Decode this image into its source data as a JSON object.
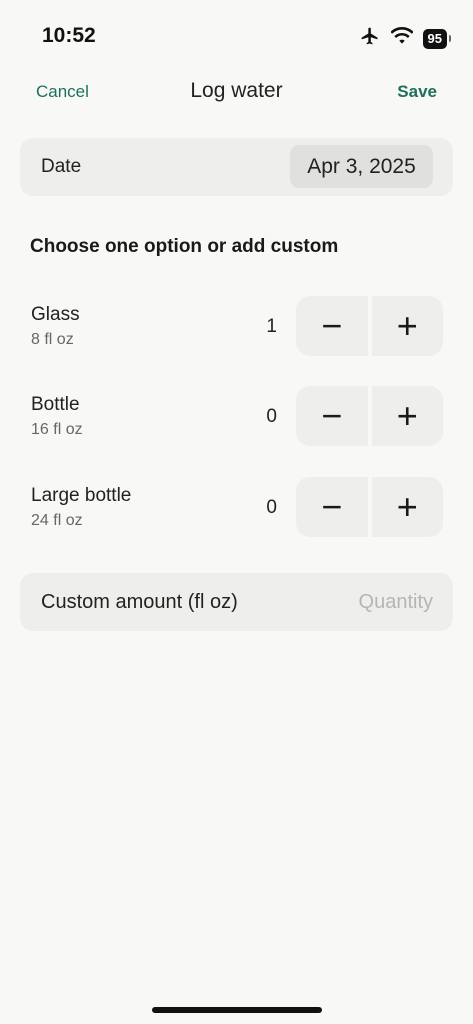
{
  "status": {
    "time": "10:52",
    "battery": "95"
  },
  "nav": {
    "cancel": "Cancel",
    "title": "Log water",
    "save": "Save"
  },
  "date": {
    "label": "Date",
    "value": "Apr 3, 2025"
  },
  "section_title": "Choose one option or add custom",
  "options": [
    {
      "name": "Glass",
      "size": "8 fl oz",
      "count": "1"
    },
    {
      "name": "Bottle",
      "size": "16 fl oz",
      "count": "0"
    },
    {
      "name": "Large bottle",
      "size": "24 fl oz",
      "count": "0"
    }
  ],
  "stepper": {
    "minus": "−",
    "plus": "+"
  },
  "custom": {
    "label": "Custom amount (fl oz)",
    "placeholder": "Quantity"
  }
}
